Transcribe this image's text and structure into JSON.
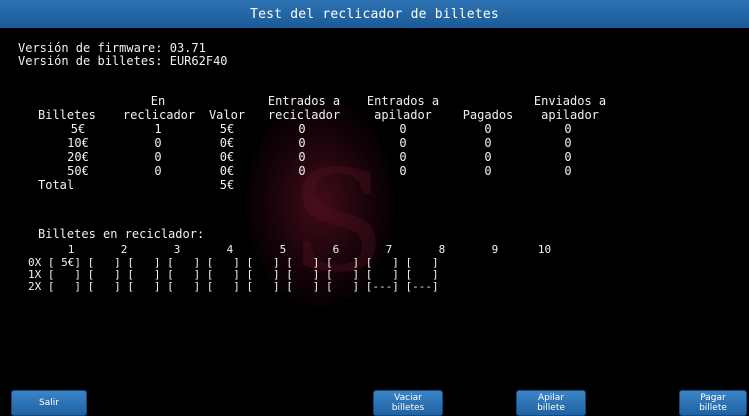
{
  "title": "Test del reclicador de billetes",
  "info": {
    "firmware_line": "Versión de firmware: 03.71",
    "billetes_line": "Versión de billetes: EUR62F40"
  },
  "table": {
    "headers": {
      "billetes": "Billetes",
      "en_top": "En",
      "en_bottom": "reclicador",
      "valor": "Valor",
      "entrados_rec_top": "Entrados a",
      "entrados_rec_bottom": "reciclador",
      "entrados_api_top": "Entrados a",
      "entrados_api_bottom": "apilador",
      "pagados": "Pagados",
      "enviados_top": "Enviados a",
      "enviados_bottom": "apilador"
    },
    "rows": [
      {
        "billete": "5€",
        "en": "1",
        "valor": "5€",
        "ent_rec": "0",
        "ent_api": "0",
        "pagados": "0",
        "enviados": "0"
      },
      {
        "billete": "10€",
        "en": "0",
        "valor": "0€",
        "ent_rec": "0",
        "ent_api": "0",
        "pagados": "0",
        "enviados": "0"
      },
      {
        "billete": "20€",
        "en": "0",
        "valor": "0€",
        "ent_rec": "0",
        "ent_api": "0",
        "pagados": "0",
        "enviados": "0"
      },
      {
        "billete": "50€",
        "en": "0",
        "valor": "0€",
        "ent_rec": "0",
        "ent_api": "0",
        "pagados": "0",
        "enviados": "0"
      }
    ],
    "total_label": "Total",
    "total_value": "5€"
  },
  "recycler": {
    "heading": "Billetes en reciclador:",
    "column_numbers": "      1       2       3       4       5       6       7       8       9      10",
    "rows": [
      "0X [ 5€] [   ] [   ] [   ] [   ] [   ] [   ] [   ] [   ] [   ]",
      "1X [   ] [   ] [   ] [   ] [   ] [   ] [   ] [   ] [   ] [   ]",
      "2X [   ] [   ] [   ] [   ] [   ] [   ] [   ] [   ] [---] [---]"
    ]
  },
  "buttons": {
    "salir": "Salir",
    "vaciar": "Vaciar\nbilletes",
    "apilar": "Apilar\nbillete",
    "pagar": "Pagar\nbillete"
  }
}
